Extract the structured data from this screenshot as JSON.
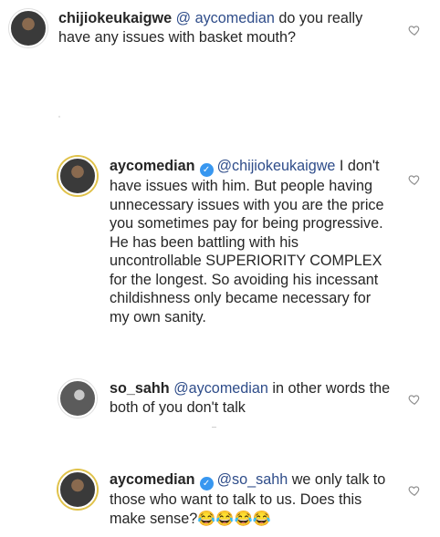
{
  "comments": [
    {
      "username": "chijiokeukaigwe",
      "verified": false,
      "mention": "@ aycomedian",
      "body": "do you really have any issues with basket mouth?"
    },
    {
      "username": "aycomedian",
      "verified": true,
      "mention": "@chijiokeukaigwe",
      "body": "I don't have issues  with  him. But people having unnecessary issues with you are the price you sometimes pay for being progressive. He has been battling with his uncontrollable SUPERIORITY COMPLEX for the longest. So avoiding his incessant childishness only became necessary for my own sanity."
    },
    {
      "username": "so_sahh",
      "verified": false,
      "mention": "@aycomedian",
      "body": "in other words the both of you don't talk"
    },
    {
      "username": "aycomedian",
      "verified": true,
      "mention": "@so_sahh",
      "body": "we only talk to those who want to talk to us. Does this make sense?😂😂😂😂"
    }
  ],
  "icons": {
    "like": "heart-outline-icon",
    "verified": "verified-badge-icon"
  }
}
